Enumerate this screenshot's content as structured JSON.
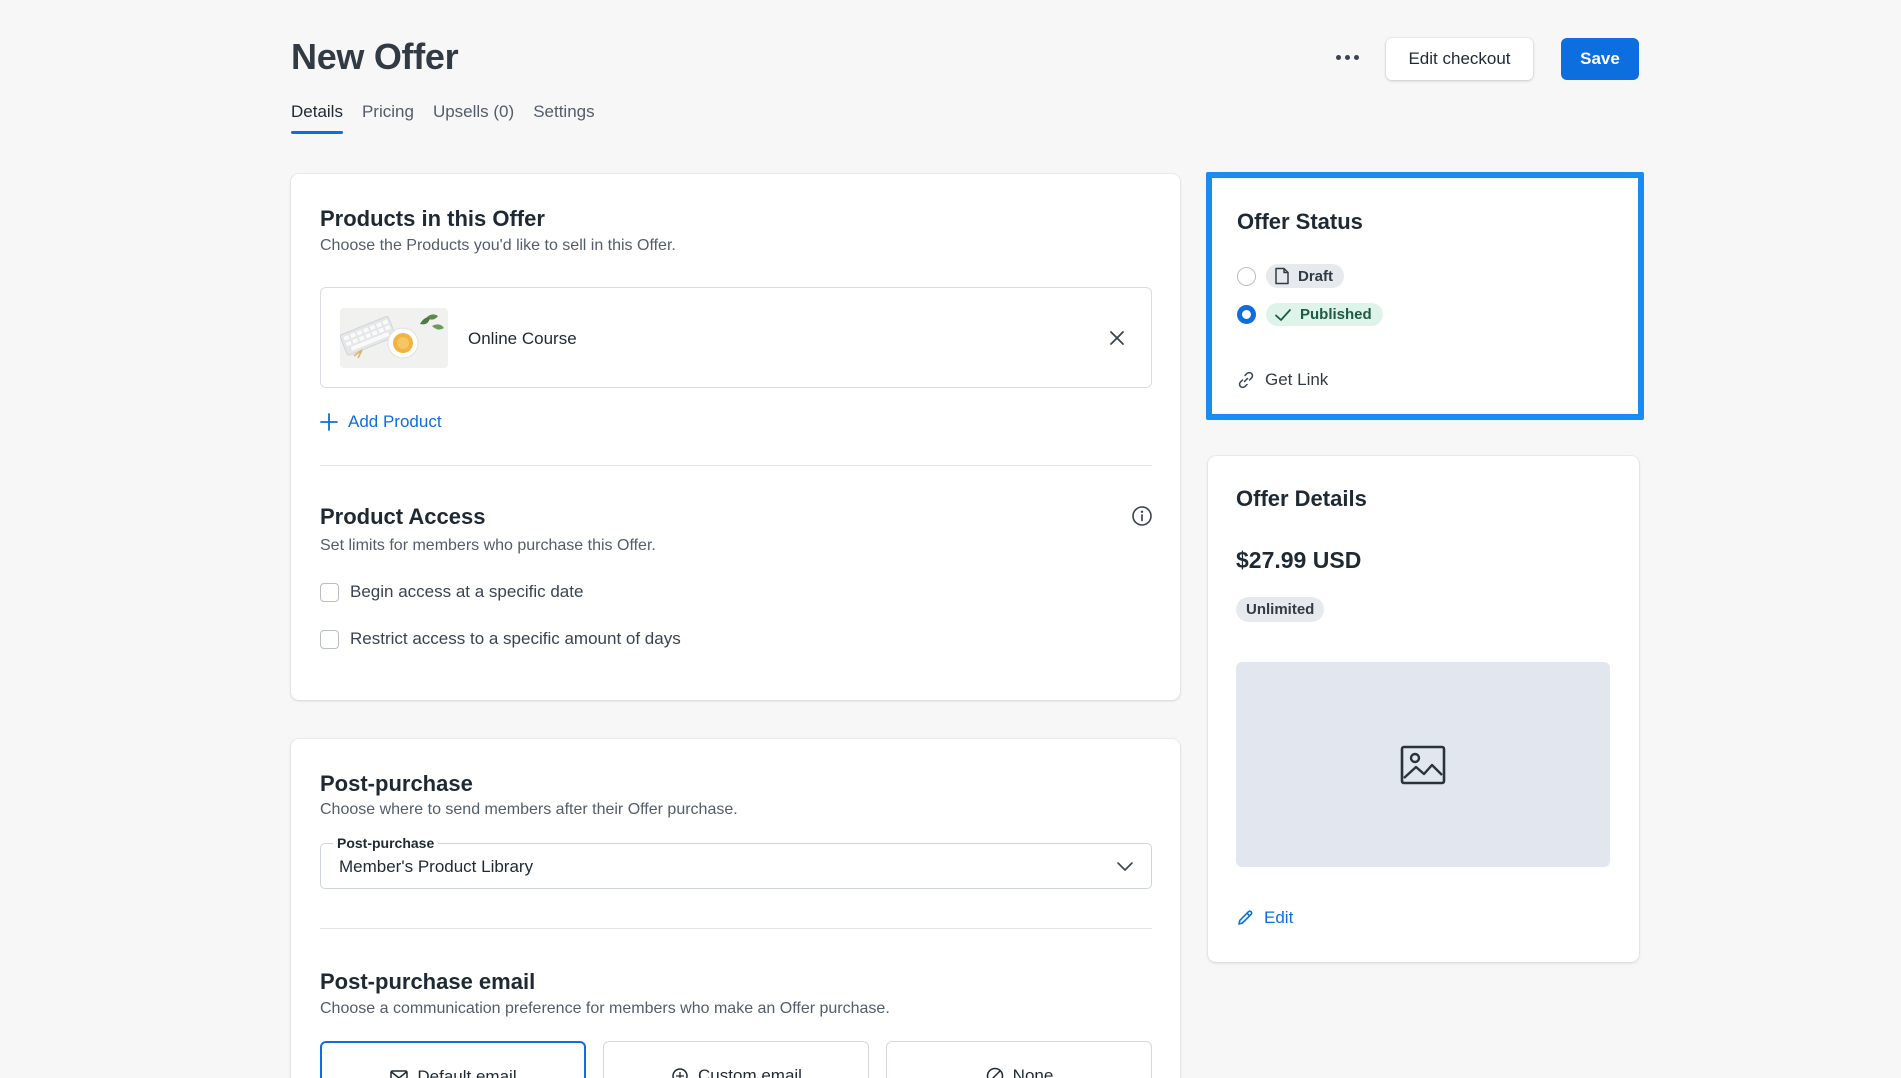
{
  "header": {
    "title": "New Offer",
    "edit_checkout_label": "Edit checkout",
    "save_label": "Save"
  },
  "tabs": [
    {
      "label": "Details",
      "active": true
    },
    {
      "label": "Pricing",
      "active": false
    },
    {
      "label": "Upsells (0)",
      "active": false
    },
    {
      "label": "Settings",
      "active": false
    }
  ],
  "products_section": {
    "title": "Products in this Offer",
    "subtitle": "Choose the Products you'd like to sell in this Offer.",
    "products": [
      {
        "name": "Online Course"
      }
    ],
    "add_label": "Add Product"
  },
  "access_section": {
    "title": "Product Access",
    "subtitle": "Set limits for members who purchase this Offer.",
    "options": [
      {
        "label": "Begin access at a specific date",
        "checked": false
      },
      {
        "label": "Restrict access to a specific amount of days",
        "checked": false
      }
    ]
  },
  "post_purchase": {
    "title": "Post-purchase",
    "subtitle": "Choose where to send members after their Offer purchase.",
    "select_label": "Post-purchase",
    "select_value": "Member's Product Library"
  },
  "post_purchase_email": {
    "title": "Post-purchase email",
    "subtitle": "Choose a communication preference for members who make an Offer purchase.",
    "options": [
      {
        "label": "Default email",
        "selected": true,
        "icon": "envelope-icon"
      },
      {
        "label": "Custom email",
        "selected": false,
        "icon": "custom-email-icon"
      },
      {
        "label": "None",
        "selected": false,
        "icon": "none-icon"
      }
    ]
  },
  "offer_status": {
    "title": "Offer Status",
    "options": [
      {
        "label": "Draft",
        "checked": false,
        "icon": "document-icon"
      },
      {
        "label": "Published",
        "checked": true,
        "icon": "check-icon"
      }
    ],
    "get_link_label": "Get Link"
  },
  "offer_details": {
    "title": "Offer Details",
    "price": "$27.99 USD",
    "badge": "Unlimited",
    "edit_label": "Edit"
  },
  "colors": {
    "primary": "#0d6ee0",
    "highlight_border": "#1a8cf0",
    "published_pill": "#def4ea"
  }
}
